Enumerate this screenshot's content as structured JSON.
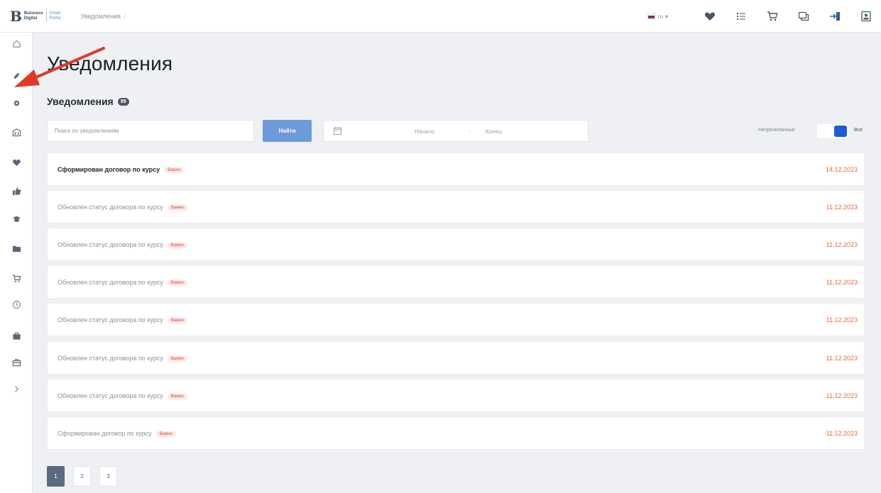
{
  "header": {
    "logo": {
      "mark": "B",
      "line1": "Buisness",
      "line2": "Digital",
      "sub1": "Smart",
      "sub2": "Portal"
    },
    "breadcrumb": "Уведомления",
    "breadcrumb_sep": "/",
    "lang": {
      "code": "ru",
      "caret": "▾"
    }
  },
  "page": {
    "title": "Уведомления",
    "section_title": "Уведомления",
    "count_badge": "99"
  },
  "filters": {
    "search_placeholder": "Поиск по уведомлениям",
    "find_button": "Найти",
    "date_from": "Начало",
    "date_sep": "-",
    "date_to": "Конец",
    "unread_label": "Непрочитанные",
    "all_label": "Все",
    "toggle_state": "all"
  },
  "notifications": [
    {
      "text": "Сформирован договор по курсу",
      "tag": "Важно",
      "date": "14.12.2023",
      "unread": true
    },
    {
      "text": "Обновлен статус договора по курсу",
      "tag": "Важно",
      "date": "11.12.2023",
      "unread": false
    },
    {
      "text": "Обновлен статус договора по курсу",
      "tag": "Важно",
      "date": "11.12.2023",
      "unread": false
    },
    {
      "text": "Обновлен статус договора по курсу",
      "tag": "Важно",
      "date": "11.12.2023",
      "unread": false
    },
    {
      "text": "Обновлен статус договора по курсу",
      "tag": "Важно",
      "date": "11.12.2023",
      "unread": false
    },
    {
      "text": "Обновлен статус договора по курсу",
      "tag": "Важно",
      "date": "11.12.2023",
      "unread": false
    },
    {
      "text": "Обновлен статус договора по курсу",
      "tag": "Важно",
      "date": "11.12.2023",
      "unread": false
    },
    {
      "text": "Сформирован договор по курсу",
      "tag": "Важно",
      "date": "11.12.2023",
      "unread": false
    }
  ],
  "pagination": {
    "pages": [
      "1",
      "2",
      "3"
    ],
    "current": "1"
  },
  "colors": {
    "accent": "#1d5bd6",
    "button": "#6d9ad8",
    "date": "#e6683c",
    "tag_bg": "#fde6e4",
    "tag_text": "#e04a3d",
    "annotation_arrow": "#e0392b"
  },
  "icons": {
    "sidebar": [
      "home-icon",
      "rocket-icon",
      "settings-icon",
      "building-icon",
      "heart-icon",
      "thumbs-up-icon",
      "graduation-cap-icon",
      "folder-icon",
      "cart-icon",
      "clock-icon",
      "briefcase-icon",
      "case-icon",
      "chevron-right-icon"
    ],
    "topbar": [
      "heart-icon",
      "list-icon",
      "cart-icon",
      "chat-icon",
      "login-icon",
      "user-card-icon"
    ]
  }
}
